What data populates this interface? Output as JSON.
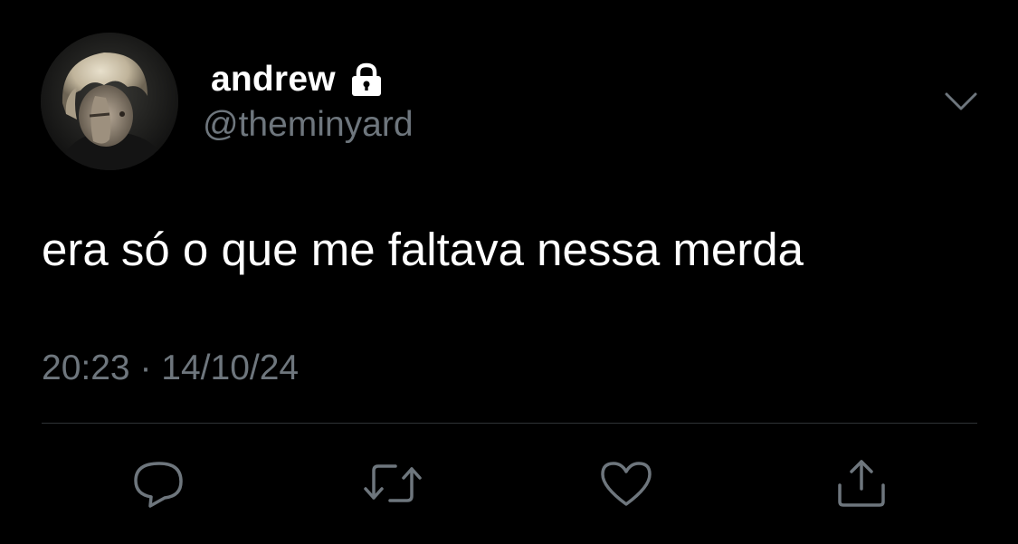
{
  "user": {
    "display_name": "andrew",
    "handle": "@theminyard",
    "protected_icon": "lock-icon",
    "avatar": "avatar-photo"
  },
  "tweet": {
    "text": "era só o que me faltava nessa merda",
    "time": "20:23",
    "separator": "·",
    "date": "14/10/24"
  },
  "actions": [
    {
      "name": "reply",
      "icon": "reply-icon"
    },
    {
      "name": "retweet",
      "icon": "retweet-icon"
    },
    {
      "name": "like",
      "icon": "heart-icon"
    },
    {
      "name": "share",
      "icon": "share-icon"
    }
  ],
  "colors": {
    "background": "#000000",
    "primary_text": "#ffffff",
    "secondary_text": "#6e767d",
    "divider": "#2f3336"
  }
}
